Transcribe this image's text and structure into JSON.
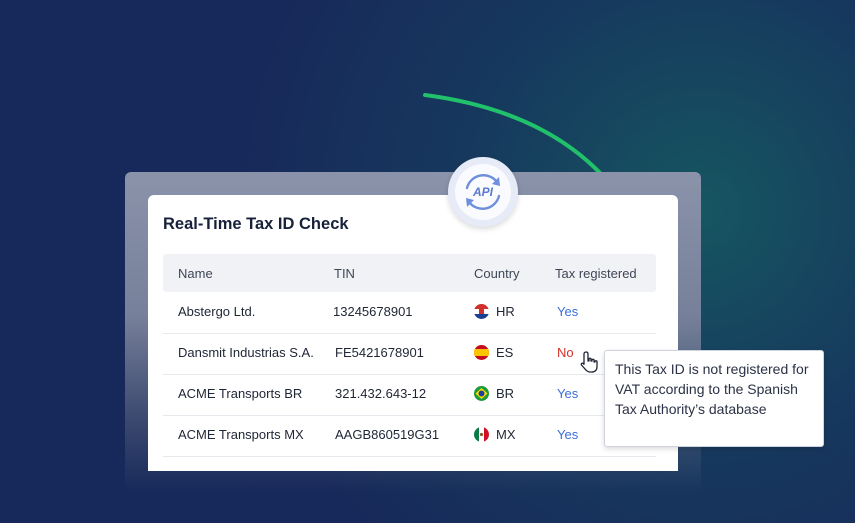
{
  "card": {
    "title": "Real-Time Tax ID Check",
    "columns": [
      "Name",
      "TIN",
      "Country",
      "Tax registered"
    ]
  },
  "rows": [
    {
      "name": "Abstergo Ltd.",
      "tin": "13245678901",
      "country": "HR",
      "registered": "Yes"
    },
    {
      "name": "Dansmit Industrias S.A.",
      "tin": "FE5421678901",
      "country": "ES",
      "registered": "No"
    },
    {
      "name": "ACME Transports BR",
      "tin": "321.432.643-12",
      "country": "BR",
      "registered": "Yes"
    },
    {
      "name": "ACME Transports MX",
      "tin": "AAGB860519G31",
      "country": "MX",
      "registered": "Yes"
    }
  ],
  "badge": {
    "label": "API",
    "icon": "api-sync-icon"
  },
  "tooltip": {
    "text": "This Tax ID is not registered for VAT according to the Spanish Tax Authority’s database"
  },
  "colors": {
    "background": "#17295a",
    "accent_green": "#21c16b",
    "yes": "#3a6fd8",
    "no": "#d6322a"
  }
}
